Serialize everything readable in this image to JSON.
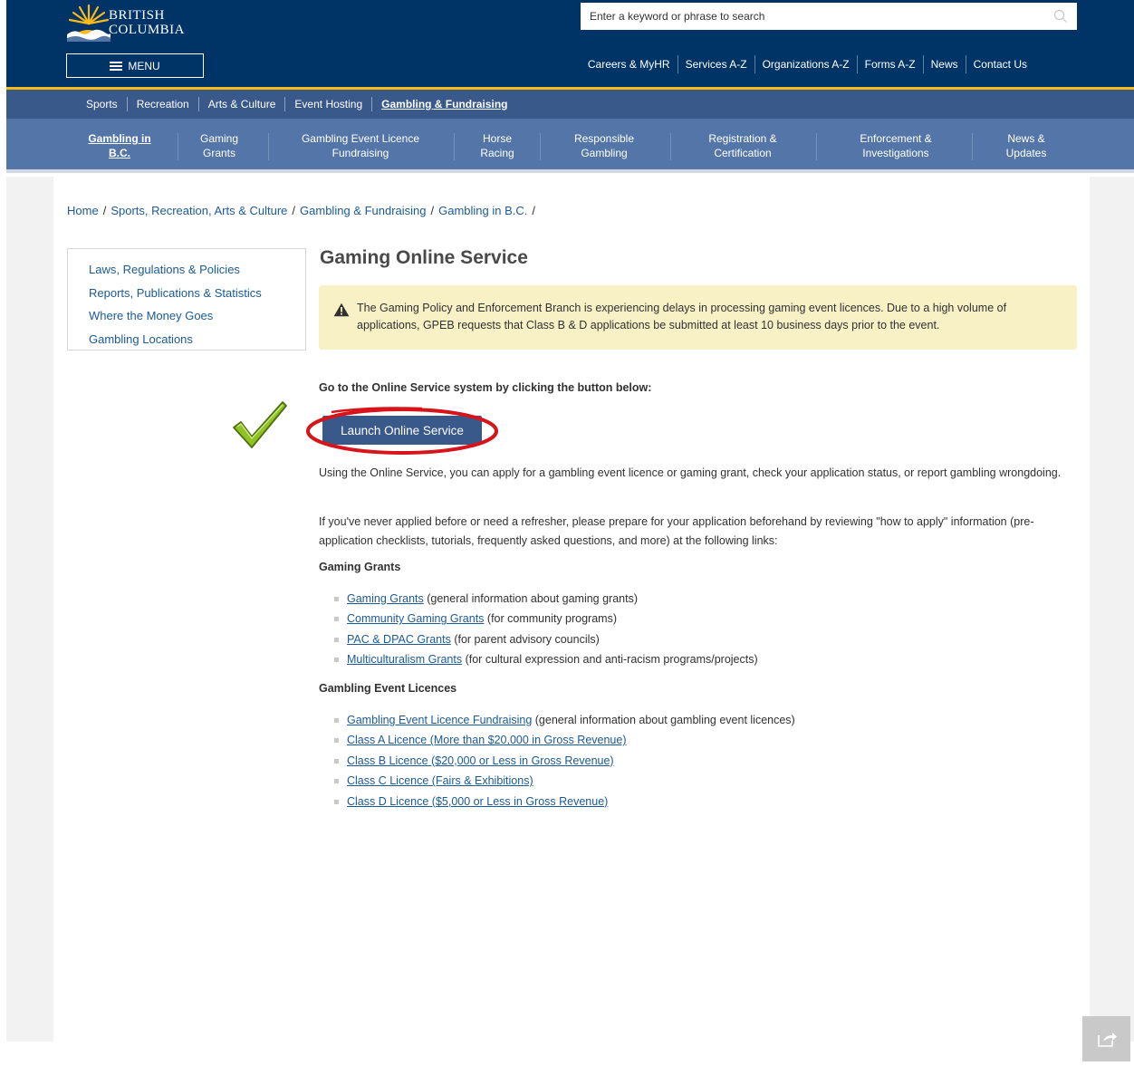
{
  "header": {
    "logo_line1": "BRITISH",
    "logo_line2": "COLUMBIA",
    "menu_label": "MENU",
    "search_placeholder": "Enter a keyword or phrase to search",
    "search_icon": "search-icon",
    "util_links": [
      "Careers & MyHR",
      "Services A-Z",
      "Organizations A-Z",
      "Forms A-Z",
      "News",
      "Contact Us"
    ]
  },
  "nav_primary": {
    "items": [
      "Sports",
      "Recreation",
      "Arts & Culture",
      "Event Hosting",
      "Gambling & Fundraising"
    ],
    "active": "Gambling & Fundraising"
  },
  "nav_secondary": {
    "items": [
      {
        "line1": "Gambling in",
        "line2": "B.C."
      },
      {
        "line1": "Gaming",
        "line2": "Grants"
      },
      {
        "line1": "Gambling Event Licence",
        "line2": "Fundraising"
      },
      {
        "line1": "Horse",
        "line2": "Racing"
      },
      {
        "line1": "Responsible",
        "line2": "Gambling"
      },
      {
        "line1": "Registration &",
        "line2": "Certification"
      },
      {
        "line1": "Enforcement &",
        "line2": "Investigations"
      },
      {
        "line1": "News &",
        "line2": "Updates"
      }
    ],
    "active": "Gambling in B.C."
  },
  "breadcrumb": [
    "Home",
    "Sports, Recreation, Arts & Culture",
    "Gambling & Fundraising",
    "Gambling in B.C."
  ],
  "sidenav": [
    "Laws, Regulations & Policies",
    "Reports, Publications & Statistics",
    "Where the Money Goes",
    "Gambling Locations"
  ],
  "main": {
    "title": "Gaming Online Service",
    "alert_text": "The Gaming Policy and Enforcement Branch is experiencing delays in processing gaming event licences. Due to a high volume of applications, GPEB requests that Class B & D applications be submitted at least 10 business days prior to the event.",
    "intro": "Go to the Online Service system by clicking the button below:",
    "launch_button": "Launch Online Service",
    "para1": "Using the Online Service, you can apply for a gambling event licence or gaming grant, check your application status, or report gambling wrongdoing.",
    "para2": "If you've never applied before or need a refresher, please prepare for your application beforehand by reviewing \"how to apply\" information (pre-application checklists, tutorials, frequently asked questions, and more) at the following links:",
    "grants_heading": "Gaming Grants",
    "grants_links": [
      {
        "link": "Gaming Grants",
        "note": " (general information about gaming grants)"
      },
      {
        "link": "Community Gaming Grants",
        "note": " (for community programs)"
      },
      {
        "link": "PAC & DPAC Grants",
        "note": " (for parent advisory councils)"
      },
      {
        "link": "Multiculturalism Grants",
        "note": " (for cultural expression and anti-racism programs/projects)"
      }
    ],
    "licences_heading": "Gambling Event Licences",
    "licences_links": [
      {
        "link": "Gambling Event Licence Fundraising",
        "note": " (general information about gambling event licences)"
      },
      {
        "link": "Class A Licence (More than $20,000 in Gross Revenue)",
        "note": ""
      },
      {
        "link": "Class B Licence ($20,000 or Less in Gross Revenue)",
        "note": ""
      },
      {
        "link": "Class C Licence (Fairs & Exhibitions)",
        "note": ""
      },
      {
        "link": "Class D Licence ($5,000 or Less in Gross Revenue)",
        "note": ""
      }
    ]
  },
  "colors": {
    "header_bg": "#003366",
    "accent_gold": "#fcba19",
    "nav1_bg": "#38598a",
    "nav2_bg": "#5475a7",
    "link": "#1a5a96",
    "alert_bg": "#f9f1c6",
    "annotation_red": "#d7141a",
    "checkmark_green": "#7aa81e"
  },
  "icons": {
    "warning": "warning-icon",
    "share": "share-icon",
    "checkmark": "checkmark-icon",
    "hamburger": "hamburger-icon"
  }
}
